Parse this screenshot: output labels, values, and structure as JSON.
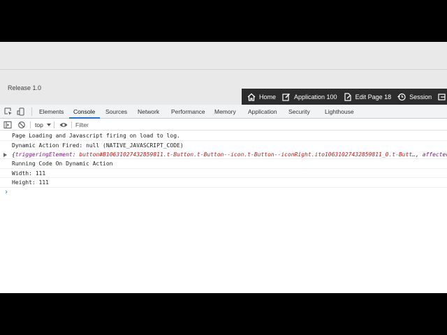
{
  "app": {
    "release_label": "Release 1.0"
  },
  "dev_toolbar": {
    "items": [
      {
        "label": "Home",
        "icon": "home-icon"
      },
      {
        "label": "Application 100",
        "icon": "edit-icon"
      },
      {
        "label": "Edit Page 18",
        "icon": "edit-page-icon"
      },
      {
        "label": "Session",
        "icon": "session-icon"
      }
    ]
  },
  "devtools": {
    "tabs": [
      "Elements",
      "Console",
      "Sources",
      "Network",
      "Performance",
      "Memory",
      "Application",
      "Security",
      "Lighthouse"
    ],
    "active_tab": "Console",
    "context": "top",
    "filter_placeholder": "Filter",
    "console": {
      "lines": [
        "Page Loading and Javascript firing on load to log.",
        "Dynamic Action Fired: null (NATIVE_JAVASCRIPT_CODE)"
      ],
      "object_preview": {
        "open": "{",
        "key1": "triggeringElement",
        "sep": ": ",
        "value1": "button#B10631027432859811.t-Button.t-Button--icon.t-Button--iconRight.ito10631027432859811_0.t-Butt…",
        "comma": ", ",
        "key2": "affectedElements"
      },
      "lines_after": [
        "Running Code On Dynamic Action",
        "Width: 111",
        "Height: 111"
      ],
      "prompt": "›"
    }
  },
  "colors": {
    "toolbar_bg": "#2c2c2c",
    "active_tab_underline": "#1a73e8",
    "console_key": "#881391",
    "console_value": "#c41a16"
  }
}
